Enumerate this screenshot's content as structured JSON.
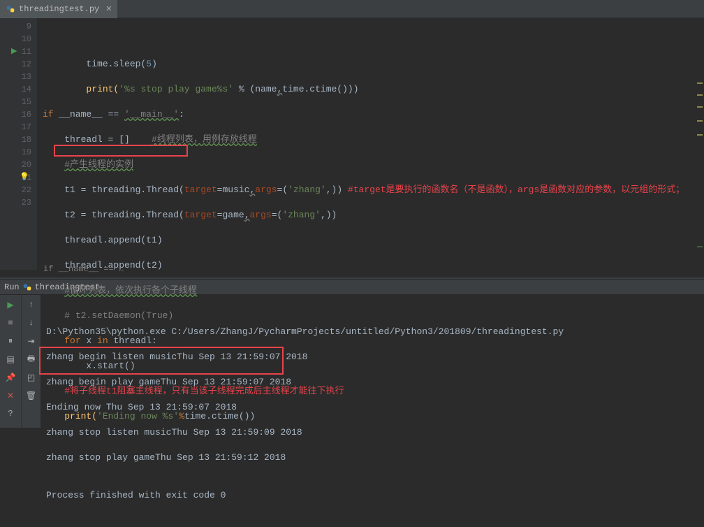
{
  "tab": {
    "filename": "threadingtest.py"
  },
  "gutter": {
    "lines": [
      "9",
      "10",
      "11",
      "12",
      "13",
      "14",
      "15",
      "16",
      "17",
      "18",
      "19",
      "20",
      "21",
      "22",
      "23"
    ]
  },
  "code": {
    "l9": {
      "a": "time.sleep(",
      "n": "5",
      "b": ")"
    },
    "l10": {
      "a": "print(",
      "s": "'%s stop play game%s'",
      "b": " % (name",
      "c": "time.ctime()))",
      "u": ","
    },
    "l11": {
      "kw1": "if ",
      "n1": "__name__ ",
      "eq": "== ",
      "s": "'__main__'",
      "c": ":"
    },
    "l12": {
      "a": "threadl = []    ",
      "c": "#线程列表，用例存放线程"
    },
    "l13": {
      "c": "#产生线程的实例"
    },
    "l14": {
      "a": "t1 = threading.Thread(",
      "t": "target",
      "b": "=music",
      "u": ",",
      "ar": "args",
      "c": "=(",
      "s": "'zhang'",
      "d": ",))",
      "cm": " #target是要执行的函数名（不是函数），args是函数对应的参数，以元组的形式；"
    },
    "l15": {
      "a": "t2 = threading.Thread(",
      "t": "target",
      "b": "=game",
      "u": ",",
      "ar": "args",
      "c": "=(",
      "s": "'zhang'",
      "d": ",))"
    },
    "l16": {
      "a": "threadl.append(t1)"
    },
    "l17": {
      "a": "threadl.append(t2)"
    },
    "l18": {
      "c": "#循环列表，依次执行各个子线程"
    },
    "l19": {
      "c": "# t2.setDaemon(True)"
    },
    "l20": {
      "f": "for ",
      "x": "x ",
      "in": "in ",
      "t": "threadl:"
    },
    "l21": {
      "a": "x.start()"
    },
    "l22": {
      "c": "#将子线程t1阻塞主线程，只有当该子线程完成后主线程才能往下执行"
    },
    "l23": {
      "a": "print(",
      "s": "'Ending now %s'",
      "pct": "%",
      "b": "time.ctime())"
    }
  },
  "breadcrumb": "if __name__ == …",
  "run": {
    "title_pre": "Run ",
    "title": "threadingtest",
    "out": [
      "D:\\Python35\\python.exe C:/Users/ZhangJ/PycharmProjects/untitled/Python3/201809/threadingtest.py",
      "zhang begin listen musicThu Sep 13 21:59:07 2018",
      "zhang begin play gameThu Sep 13 21:59:07 2018",
      "Ending now Thu Sep 13 21:59:07 2018",
      "zhang stop listen musicThu Sep 13 21:59:09 2018",
      "zhang stop play gameThu Sep 13 21:59:12 2018",
      "",
      "Process finished with exit code 0"
    ]
  }
}
